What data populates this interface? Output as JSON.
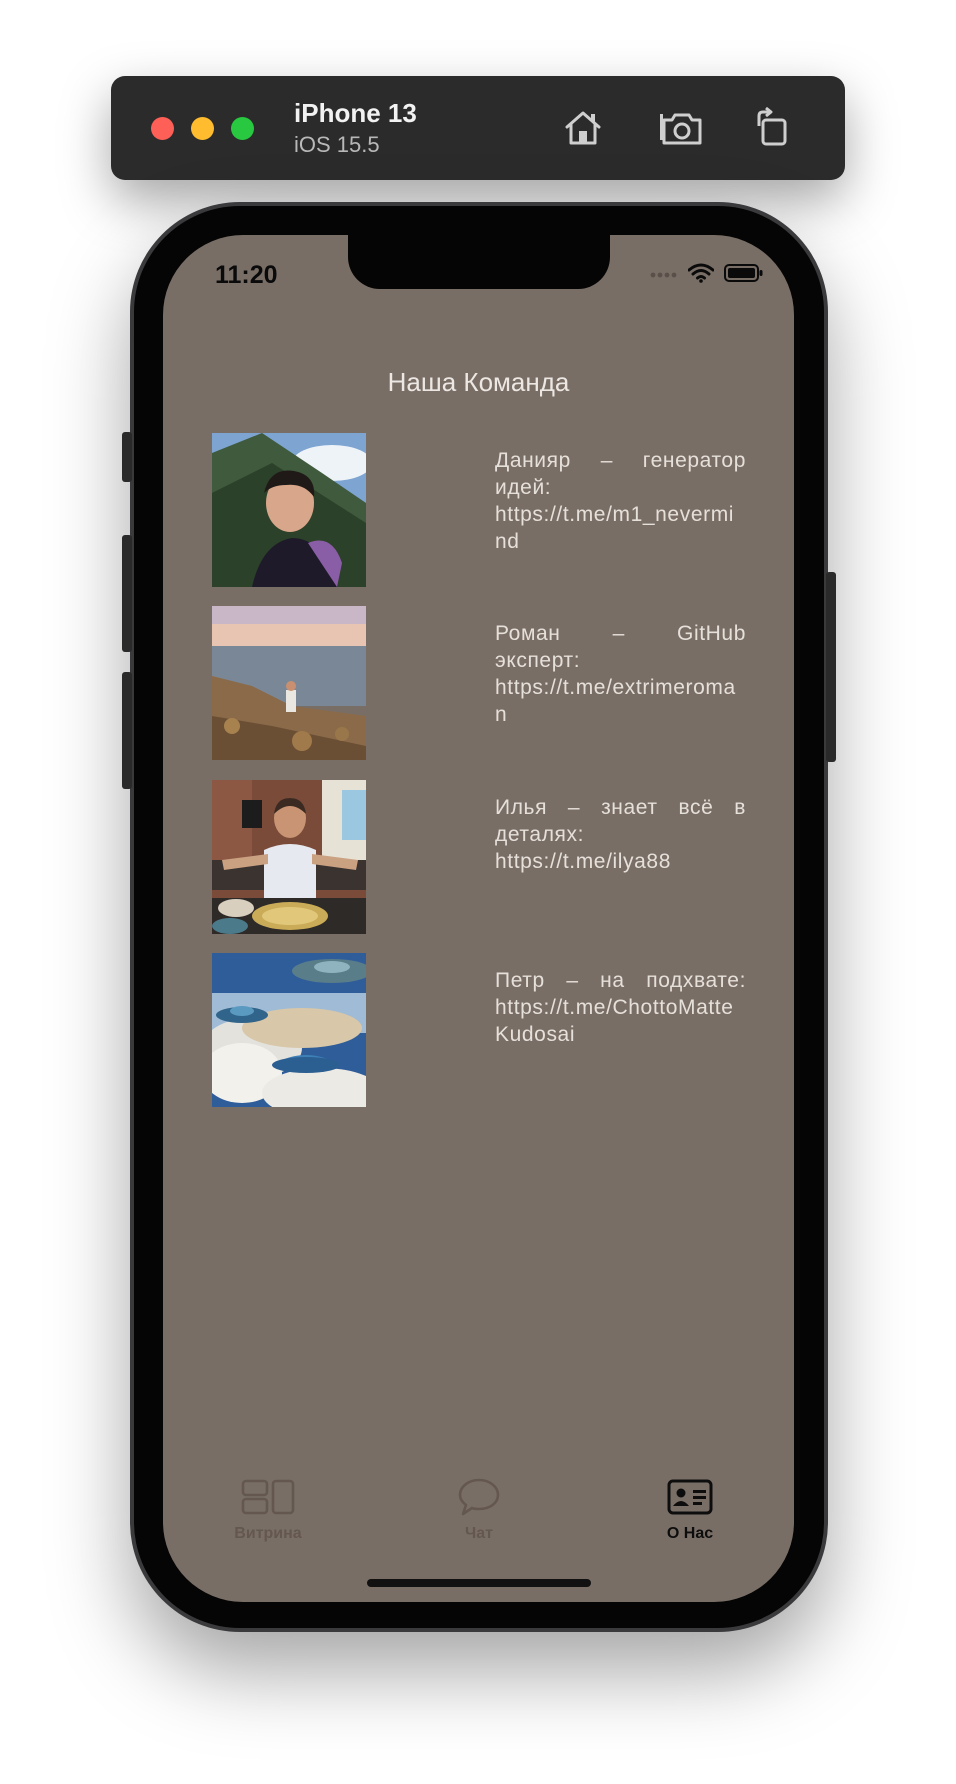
{
  "toolbar": {
    "device_name": "iPhone 13",
    "os_version": "iOS 15.5",
    "icons": [
      "home-icon",
      "screenshot-icon",
      "rotate-icon"
    ]
  },
  "status_bar": {
    "time": "11:20"
  },
  "screen": {
    "title": "Наша Команда",
    "members": [
      {
        "bio": "Данияр – генератор идей: https://t.me/m1_nevermind"
      },
      {
        "bio": "Роман – GitHub эксперт: https://t.me/extrimeroman"
      },
      {
        "bio": "Илья – знает всё в деталях: https://t.me/ilya88"
      },
      {
        "bio": "Петр – на подхвате: https://t.me/ChottoMatteKudosai"
      }
    ]
  },
  "tabbar": {
    "tabs": [
      {
        "label": "Витрина",
        "icon": "showcase-icon",
        "active": false
      },
      {
        "label": "Чат",
        "icon": "chat-bubble-icon",
        "active": false
      },
      {
        "label": "О Нас",
        "icon": "contact-card-icon",
        "active": true
      }
    ]
  },
  "colors": {
    "screen_bg": "#796e66",
    "tab_inactive": "#63574f",
    "tab_active": "#0d0d0d"
  }
}
